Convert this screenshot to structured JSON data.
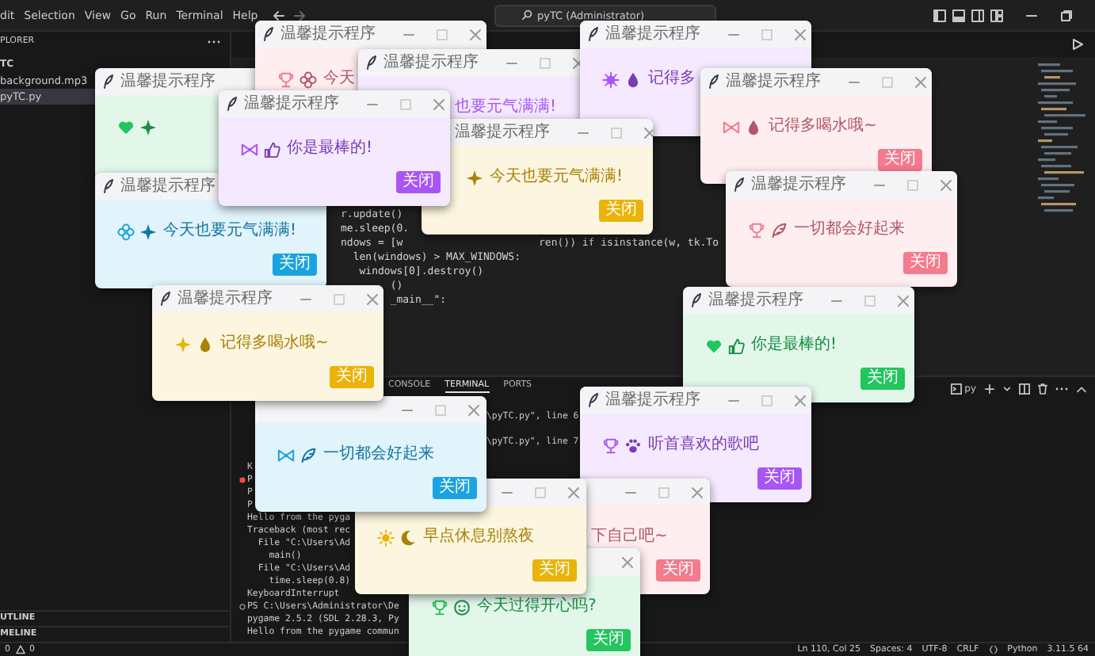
{
  "title_bar": {
    "menu": [
      "dit",
      "Selection",
      "View",
      "Go",
      "Run",
      "Terminal",
      "Help"
    ],
    "command_center": "pyTC (Administrator)"
  },
  "explorer": {
    "header": "PLORER",
    "folder": "TC",
    "files": [
      {
        "name": "background.mp3",
        "selected": false
      },
      {
        "name": "pyTC.py",
        "selected": true
      }
    ],
    "sections": [
      "UTLINE",
      "MELINE"
    ]
  },
  "editor": {
    "code_lines": [
      {
        "text": "r.update()"
      },
      {
        "text": "me.sleep(0."
      },
      {
        "text": "ndows = [w",
        "tail": "ren()) if isinstance(w, tk.To"
      },
      {
        "text": "  len(windows) > MAX_WINDOWS:"
      },
      {
        "text": "   windows[0].destroy()"
      },
      {
        "text": "        ()"
      },
      {
        "text": "        _main__\":"
      }
    ]
  },
  "panel": {
    "tabs": [
      {
        "label": "CONSOLE",
        "selected": false
      },
      {
        "label": "TERMINAL",
        "selected": true
      },
      {
        "label": "PORTS",
        "selected": false
      }
    ],
    "shell": "py",
    "lines": [
      {
        "tail": "\\pyTC.py\", line 6",
        "kind": "output"
      },
      {
        "tail": "\\pyTC.py\", line 7",
        "kind": "output"
      },
      {
        "text": "K",
        "kind": "output"
      },
      {
        "text": "P",
        "kind": "error"
      },
      {
        "text": "P",
        "kind": "output"
      },
      {
        "text": "P",
        "kind": "output"
      },
      {
        "text": "Hello from the pyga",
        "kind": "output"
      },
      {
        "text": "Traceback (most rec",
        "kind": "output"
      },
      {
        "text": "  File \"C:\\Users\\Ad",
        "kind": "output"
      },
      {
        "text": "    main()",
        "kind": "output"
      },
      {
        "text": "  File \"C:\\Users\\Ad",
        "kind": "output"
      },
      {
        "text": "    time.sleep(0.8)",
        "kind": "output"
      },
      {
        "text": "KeyboardInterrupt",
        "kind": "output"
      },
      {
        "text": "PS C:\\Users\\Administrator\\De",
        "kind": "prompt"
      },
      {
        "text": "pygame 2.5.2 (SDL 2.28.3, Py",
        "kind": "output"
      },
      {
        "text": "Hello from the pygame commun",
        "kind": "output"
      }
    ]
  },
  "status_bar": {
    "errors": "0",
    "warnings": "0",
    "items": [
      {
        "text": "Ln 110, Col 25",
        "kind": "text"
      },
      {
        "text": "Spaces: 4",
        "kind": "text"
      },
      {
        "text": "UTF-8",
        "kind": "text"
      },
      {
        "text": "CRLF",
        "kind": "text"
      },
      {
        "text": "Python",
        "kind": "language"
      },
      {
        "text": "3.11.5 64",
        "kind": "text"
      }
    ]
  },
  "windows": [
    {
      "title": "温馨提示程序",
      "color": "#22c55e"
    },
    {
      "title": "温馨提示程序",
      "message": "今天",
      "color": "#f47a8d"
    },
    {
      "title": "温馨提示程序",
      "message": "今天也要元气满满!",
      "button": "关闭",
      "color": "#1aa3e0"
    },
    {
      "title": "温馨提示程序",
      "message": "也要元气满满!",
      "color": "#a855f7"
    },
    {
      "title": "温馨提示程序",
      "message": "记得多",
      "color": "#a855f7"
    },
    {
      "title": "温馨提示程序",
      "message": "今天也要元气满满!",
      "button": "关闭",
      "color": "#eab308"
    },
    {
      "title": "温馨提示程序",
      "message": "你是最棒的!",
      "button": "关闭",
      "color": "#a855f7"
    },
    {
      "title": "温馨提示程序",
      "message": "记得多喝水哦~",
      "button": "关闭",
      "color": "#f47a8d"
    },
    {
      "title": "温馨提示程序",
      "message": "一切都会好起来",
      "button": "关闭",
      "color": "#f47a8d"
    },
    {
      "title": "温馨提示程序",
      "message": "你是最棒的!",
      "button": "关闭",
      "color": "#22c55e"
    },
    {
      "title": "温馨提示程序",
      "message": "听首喜欢的歌吧",
      "button": "关闭",
      "color": "#a855f7"
    },
    {
      "message": "下自己吧~",
      "button": "关闭",
      "color": "#f47a8d"
    },
    {
      "message": "今天过得开心吗?",
      "button": "关闭",
      "color": "#22c55e"
    },
    {
      "message": "早点休息别熬夜",
      "button": "关闭",
      "color": "#eab308"
    },
    {
      "message": "一切都会好起来",
      "button": "关闭",
      "color": "#1aa3e0"
    },
    {
      "title": "温馨提示程序",
      "message": "记得多喝水哦~",
      "button": "关闭",
      "color": "#eab308"
    }
  ]
}
